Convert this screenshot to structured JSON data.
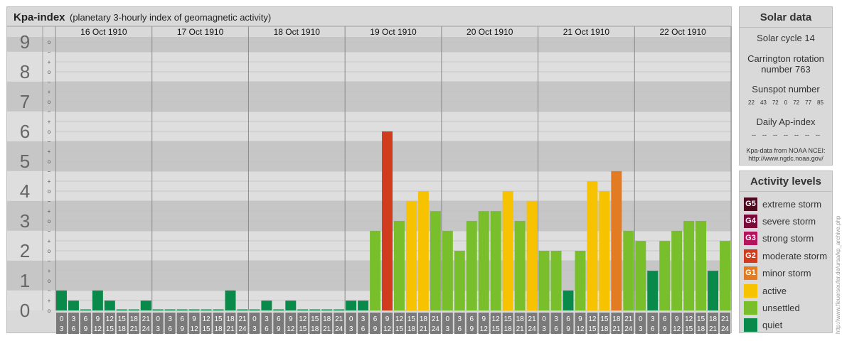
{
  "header": {
    "title": "Kpa-index",
    "subtitle": "(planetary 3-hourly index of geomagnetic activity)"
  },
  "chart_data": {
    "type": "bar",
    "y_tick_labels": [
      "0",
      "1",
      "2",
      "3",
      "4",
      "5",
      "6",
      "7",
      "8",
      "9"
    ],
    "y_minor_marks": [
      "o",
      "+",
      "−"
    ],
    "ylim": [
      0,
      9.33
    ],
    "days": [
      "16 Oct 1910",
      "17 Oct 1910",
      "18 Oct 1910",
      "19 Oct 1910",
      "20 Oct 1910",
      "21 Oct 1910",
      "22 Oct 1910"
    ],
    "interval_labels": [
      [
        "0",
        "3"
      ],
      [
        "3",
        "6"
      ],
      [
        "6",
        "9"
      ],
      [
        "9",
        "12"
      ],
      [
        "12",
        "15"
      ],
      [
        "15",
        "18"
      ],
      [
        "18",
        "21"
      ],
      [
        "21",
        "24"
      ]
    ],
    "values": [
      [
        0.67,
        0.33,
        0,
        0.67,
        0.33,
        0,
        0,
        0.33
      ],
      [
        0,
        0,
        0,
        0,
        0,
        0,
        0.67,
        0
      ],
      [
        0,
        0.33,
        0,
        0.33,
        0,
        0,
        0,
        0
      ],
      [
        0.33,
        0.33,
        2.67,
        6,
        3,
        3.67,
        4,
        3.33
      ],
      [
        2.67,
        2,
        3,
        3.33,
        3.33,
        4,
        3,
        3.67
      ],
      [
        2,
        2,
        0.67,
        2,
        4.33,
        4,
        4.67,
        2.67
      ],
      [
        2.33,
        1.33,
        2.33,
        2.67,
        3,
        3,
        1.33,
        2.33
      ]
    ],
    "grid": true
  },
  "solar": {
    "title": "Solar data",
    "cycle": "Solar cycle 14",
    "carrington_line1": "Carrington rotation",
    "carrington_line2": "number 763",
    "sunspot_title": "Sunspot number",
    "sunspot_numbers": [
      "22",
      "43",
      "72",
      "0",
      "72",
      "77",
      "85"
    ],
    "ap_title": "Daily Ap-index",
    "ap_values": [
      "--",
      "--",
      "--",
      "--",
      "--",
      "--",
      "--"
    ],
    "source_line1": "Kpa-data from NOAA NCEI:",
    "source_line2": "http://www.ngdc.noaa.gov/"
  },
  "activity": {
    "title": "Activity levels",
    "levels": [
      {
        "code": "G5",
        "label": "extreme storm",
        "color": "#4d0a1f"
      },
      {
        "code": "G4",
        "label": "severe storm",
        "color": "#7a0a3a"
      },
      {
        "code": "G3",
        "label": "strong storm",
        "color": "#b3145d"
      },
      {
        "code": "G2",
        "label": "moderate storm",
        "color": "#d13c1f"
      },
      {
        "code": "G1",
        "label": "minor storm",
        "color": "#e37b22"
      },
      {
        "code": "",
        "label": "active",
        "color": "#f7c300"
      },
      {
        "code": "",
        "label": "unsettled",
        "color": "#79bf2b"
      },
      {
        "code": "",
        "label": "quiet",
        "color": "#0a8a4a"
      }
    ]
  },
  "credit": "http://www.fleuerseufer.de/ursa/kp_archive.php",
  "colors": {
    "quiet": "#0a8a4a",
    "unsettled": "#79bf2b",
    "active": "#f7c300",
    "g1": "#e37b22",
    "g2": "#d13c1f",
    "band_dark": "#c6c6c6",
    "band_light": "#dedede",
    "tick_box": "#7a7a7a"
  }
}
